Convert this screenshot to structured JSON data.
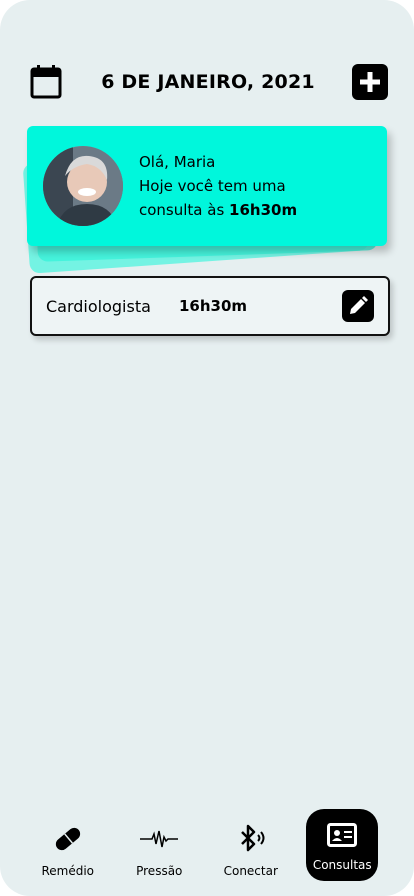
{
  "header": {
    "date_title": "6 DE JANEIRO, 2021",
    "calendar_icon": "calendar-icon",
    "add_icon": "plus-icon"
  },
  "greeting": {
    "line1": "Olá, Maria",
    "line2": "Hoje você tem uma",
    "line3_prefix": "consulta às ",
    "line3_time": "16h30m",
    "avatar": "user-photo"
  },
  "appointments": [
    {
      "specialty": "Cardiologista",
      "time": "16h30m",
      "edit_icon": "pencil-icon"
    }
  ],
  "nav": {
    "items": [
      {
        "label": "Remédio",
        "icon": "pill-icon"
      },
      {
        "label": "Pressão",
        "icon": "heartbeat-icon"
      },
      {
        "label": "Conectar",
        "icon": "bluetooth-icon"
      },
      {
        "label": "Consultas",
        "icon": "id-card-icon",
        "active": true
      }
    ]
  },
  "colors": {
    "background": "#e6eff0",
    "accent": "#00f7dc",
    "dark": "#000000"
  }
}
